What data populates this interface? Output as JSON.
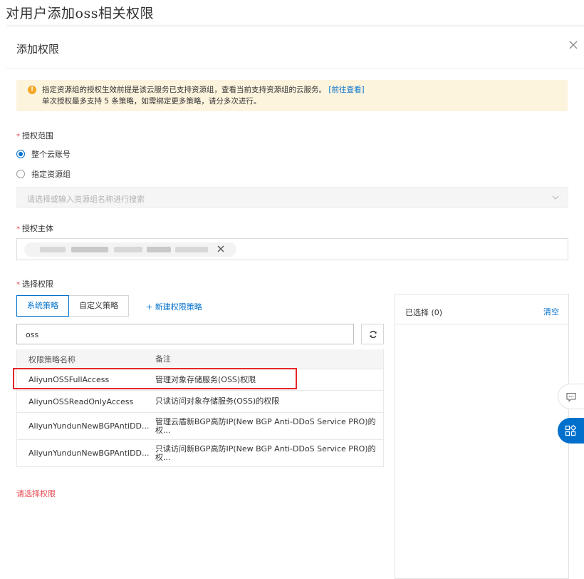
{
  "doc": {
    "heading": "对用户添加oss相关权限"
  },
  "dialog": {
    "title": "添加权限",
    "alert": {
      "line1": "指定资源组的授权生效前提是该云服务已支持资源组，查看当前支持资源组的云服务。",
      "link": "[前往查看]",
      "line2": "单次授权最多支持 5 条策略，如需绑定更多策略，请分多次进行。"
    },
    "scope": {
      "required_mark": "*",
      "label": "授权范围",
      "options": [
        {
          "label": "整个云账号",
          "checked": true
        },
        {
          "label": "指定资源组",
          "checked": false
        }
      ],
      "resource_group_placeholder": "请选择或输入资源组名称进行搜索"
    },
    "principal": {
      "required_mark": "*",
      "label": "授权主体"
    },
    "permissions": {
      "required_mark": "*",
      "label": "选择权限",
      "tabs": [
        {
          "label": "系统策略",
          "active": true
        },
        {
          "label": "自定义策略",
          "active": false
        }
      ],
      "new_policy_link": "+ 新建权限策略",
      "search_value": "oss",
      "table": {
        "columns": [
          "权限策略名称",
          "备注"
        ],
        "rows": [
          {
            "name": "AliyunOSSFullAccess",
            "note": "管理对象存储服务(OSS)权限"
          },
          {
            "name": "AliyunOSSReadOnlyAccess",
            "note": "只读访问对象存储服务(OSS)的权限"
          },
          {
            "name": "AliyunYundunNewBGPAntiDD...",
            "note": "管理云盾新BGP高防IP(New BGP Anti-DDoS Service PRO)的权..."
          },
          {
            "name": "AliyunYundunNewBGPAntiDD...",
            "note": "只读访问新BGP高防IP(New BGP Anti-DDoS Service PRO)的权..."
          }
        ]
      },
      "error": "请选择权限"
    },
    "selected": {
      "title": "已选择 (0)",
      "clear": "清空"
    }
  },
  "colors": {
    "accent": "#0070cc",
    "alert_bg": "#fdf4de",
    "highlight": "#e5262b",
    "error": "#e5484d"
  },
  "icons": [
    "close-icon",
    "warning-icon",
    "chevron-down-icon",
    "tag-remove-icon",
    "refresh-icon",
    "feedback-icon",
    "apps-grid-icon"
  ]
}
